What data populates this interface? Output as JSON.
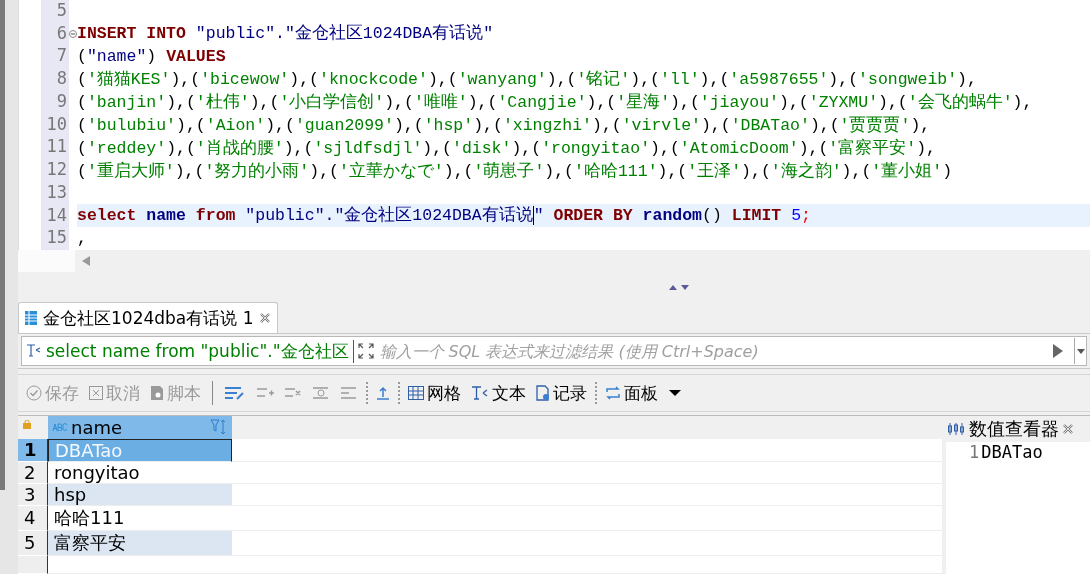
{
  "editor": {
    "lines": [
      {
        "number": "5",
        "current": false
      },
      {
        "number": "6",
        "fold_marker": true,
        "current": false,
        "tokens": [
          {
            "kind": "keyword",
            "text": "INSERT INTO "
          },
          {
            "kind": "quoted",
            "text": "\"public\".\"金仓社区1024DBA有话说\""
          }
        ]
      },
      {
        "number": "7",
        "current": false,
        "tokens": [
          {
            "kind": "punct",
            "text": "("
          },
          {
            "kind": "quoted",
            "text": "\"name\""
          },
          {
            "kind": "punct",
            "text": ") "
          },
          {
            "kind": "keyword",
            "text": "VALUES"
          }
        ]
      },
      {
        "number": "8",
        "current": false,
        "tokens": [
          {
            "kind": "punct",
            "text": "("
          },
          {
            "kind": "string",
            "text": "'猫猫KES'"
          },
          {
            "kind": "punct",
            "text": "),("
          },
          {
            "kind": "string",
            "text": "'bicewow'"
          },
          {
            "kind": "punct",
            "text": "),("
          },
          {
            "kind": "string",
            "text": "'knockcode'"
          },
          {
            "kind": "punct",
            "text": "),("
          },
          {
            "kind": "string",
            "text": "'wanyang'"
          },
          {
            "kind": "punct",
            "text": "),("
          },
          {
            "kind": "string",
            "text": "'铭记'"
          },
          {
            "kind": "punct",
            "text": "),("
          },
          {
            "kind": "string",
            "text": "'ll'"
          },
          {
            "kind": "punct",
            "text": "),("
          },
          {
            "kind": "string",
            "text": "'a5987655'"
          },
          {
            "kind": "punct",
            "text": "),("
          },
          {
            "kind": "string",
            "text": "'songweib'"
          },
          {
            "kind": "punct",
            "text": "),"
          }
        ]
      },
      {
        "number": "9",
        "current": false,
        "tokens": [
          {
            "kind": "punct",
            "text": "("
          },
          {
            "kind": "string",
            "text": "'banjin'"
          },
          {
            "kind": "punct",
            "text": "),("
          },
          {
            "kind": "string",
            "text": "'杜伟'"
          },
          {
            "kind": "punct",
            "text": "),("
          },
          {
            "kind": "string",
            "text": "'小白学信创'"
          },
          {
            "kind": "punct",
            "text": "),("
          },
          {
            "kind": "string",
            "text": "'唯唯'"
          },
          {
            "kind": "punct",
            "text": "),("
          },
          {
            "kind": "string",
            "text": "'Cangjie'"
          },
          {
            "kind": "punct",
            "text": "),("
          },
          {
            "kind": "string",
            "text": "'星海'"
          },
          {
            "kind": "punct",
            "text": "),("
          },
          {
            "kind": "string",
            "text": "'jiayou'"
          },
          {
            "kind": "punct",
            "text": "),("
          },
          {
            "kind": "string",
            "text": "'ZYXMU'"
          },
          {
            "kind": "punct",
            "text": "),("
          },
          {
            "kind": "string",
            "text": "'会飞的蜗牛'"
          },
          {
            "kind": "punct",
            "text": "),"
          }
        ]
      },
      {
        "number": "10",
        "current": false,
        "tokens": [
          {
            "kind": "punct",
            "text": "("
          },
          {
            "kind": "string",
            "text": "'bulubiu'"
          },
          {
            "kind": "punct",
            "text": "),("
          },
          {
            "kind": "string",
            "text": "'Aion'"
          },
          {
            "kind": "punct",
            "text": "),("
          },
          {
            "kind": "string",
            "text": "'guan2099'"
          },
          {
            "kind": "punct",
            "text": "),("
          },
          {
            "kind": "string",
            "text": "'hsp'"
          },
          {
            "kind": "punct",
            "text": "),("
          },
          {
            "kind": "string",
            "text": "'xingzhi'"
          },
          {
            "kind": "punct",
            "text": "),("
          },
          {
            "kind": "string",
            "text": "'virvle'"
          },
          {
            "kind": "punct",
            "text": "),("
          },
          {
            "kind": "string",
            "text": "'DBATao'"
          },
          {
            "kind": "punct",
            "text": "),("
          },
          {
            "kind": "string",
            "text": "'贾贾贾'"
          },
          {
            "kind": "punct",
            "text": "),"
          }
        ]
      },
      {
        "number": "11",
        "current": false,
        "tokens": [
          {
            "kind": "punct",
            "text": "("
          },
          {
            "kind": "string",
            "text": "'reddey'"
          },
          {
            "kind": "punct",
            "text": "),("
          },
          {
            "kind": "string",
            "text": "'肖战的腰'"
          },
          {
            "kind": "punct",
            "text": "),("
          },
          {
            "kind": "string",
            "text": "'sjldfsdjl'"
          },
          {
            "kind": "punct",
            "text": "),("
          },
          {
            "kind": "string",
            "text": "'disk'"
          },
          {
            "kind": "punct",
            "text": "),("
          },
          {
            "kind": "string",
            "text": "'rongyitao'"
          },
          {
            "kind": "punct",
            "text": "),("
          },
          {
            "kind": "string",
            "text": "'AtomicDoom'"
          },
          {
            "kind": "punct",
            "text": "),("
          },
          {
            "kind": "string",
            "text": "'富察平安'"
          },
          {
            "kind": "punct",
            "text": "),"
          }
        ]
      },
      {
        "number": "12",
        "current": false,
        "tokens": [
          {
            "kind": "punct",
            "text": "("
          },
          {
            "kind": "string",
            "text": "'重启大师'"
          },
          {
            "kind": "punct",
            "text": "),("
          },
          {
            "kind": "string",
            "text": "'努力的小雨'"
          },
          {
            "kind": "punct",
            "text": "),("
          },
          {
            "kind": "string",
            "text": "'立華かなで'"
          },
          {
            "kind": "punct",
            "text": "),("
          },
          {
            "kind": "string",
            "text": "'萌崽子'"
          },
          {
            "kind": "punct",
            "text": "),("
          },
          {
            "kind": "string",
            "text": "'哈哈111'"
          },
          {
            "kind": "punct",
            "text": "),("
          },
          {
            "kind": "string",
            "text": "'王泽'"
          },
          {
            "kind": "punct",
            "text": "),("
          },
          {
            "kind": "string",
            "text": "'海之韵'"
          },
          {
            "kind": "punct",
            "text": "),("
          },
          {
            "kind": "string",
            "text": "'董小姐'"
          },
          {
            "kind": "punct",
            "text": ")"
          }
        ]
      },
      {
        "number": "13",
        "current": false
      },
      {
        "number": "14",
        "current": true,
        "tokens": [
          {
            "kind": "keyword",
            "text": "select "
          },
          {
            "kind": "name",
            "text": "name "
          },
          {
            "kind": "keyword",
            "text": "from "
          },
          {
            "kind": "quoted",
            "text": "\"public\".\"金仓社区1024DBA有话说"
          },
          {
            "kind": "caret"
          },
          {
            "kind": "quoted",
            "text": "\" "
          },
          {
            "kind": "keyword",
            "text": "ORDER BY "
          },
          {
            "kind": "name",
            "text": "random"
          },
          {
            "kind": "punct",
            "text": "() "
          },
          {
            "kind": "keyword",
            "text": "LIMIT "
          },
          {
            "kind": "number",
            "text": "5"
          },
          {
            "kind": "delimiter",
            "text": ";"
          }
        ]
      },
      {
        "number": "15",
        "current": false,
        "tokens": [
          {
            "kind": "punct",
            "text": ","
          }
        ]
      }
    ]
  },
  "results_tab": {
    "title": "金仓社区1024dba有话说 1",
    "selected": true
  },
  "filter": {
    "query": "select name from \"public\".\"金仓社区",
    "placeholder": "输入一个 SQL 表达式来过滤结果 (使用 Ctrl+Space)"
  },
  "toolbar": [
    {
      "kind": "save",
      "label": "保存",
      "disabled": true
    },
    {
      "kind": "cancel",
      "label": "取消",
      "disabled": true
    },
    {
      "kind": "script",
      "label": "脚本",
      "disabled": true
    },
    {
      "kind": "separator"
    },
    {
      "kind": "edit",
      "disabled": false
    },
    {
      "kind": "add-row",
      "disabled": true
    },
    {
      "kind": "copy-row",
      "disabled": true
    },
    {
      "kind": "delete-row",
      "disabled": true
    },
    {
      "kind": "list",
      "disabled": true
    },
    {
      "kind": "dots"
    },
    {
      "kind": "export",
      "disabled": false
    },
    {
      "kind": "dots"
    },
    {
      "kind": "grid",
      "label": "网格",
      "disabled": false
    },
    {
      "kind": "text",
      "label": "文本",
      "disabled": false
    },
    {
      "kind": "record",
      "label": "记录",
      "disabled": false
    },
    {
      "kind": "dots"
    },
    {
      "kind": "panel",
      "label": "面板",
      "disabled": false
    },
    {
      "kind": "menu",
      "disabled": false
    }
  ],
  "grid": {
    "columns": [
      {
        "label": "name"
      }
    ],
    "rows": [
      {
        "number": "1",
        "cells": [
          "DBATao"
        ],
        "selected": true
      },
      {
        "number": "2",
        "cells": [
          "rongyitao"
        ],
        "selected": false
      },
      {
        "number": "3",
        "cells": [
          "hsp"
        ],
        "selected": false
      },
      {
        "number": "4",
        "cells": [
          "哈哈111"
        ],
        "selected": false
      },
      {
        "number": "5",
        "cells": [
          "富察平安"
        ],
        "selected": false
      }
    ]
  },
  "value_viewer": {
    "title": "数值查看器",
    "lines": [
      {
        "number": "1",
        "text": "DBATao"
      }
    ]
  }
}
